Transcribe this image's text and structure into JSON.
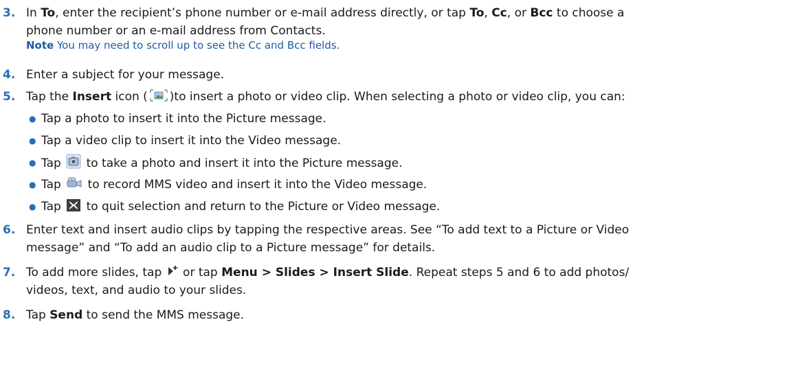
{
  "step3": {
    "num": "3.",
    "p1": "In ",
    "b1": "To",
    "p2": ", enter the recipient’s phone number or e-mail address directly, or tap ",
    "b2": "To",
    "p3": ", ",
    "b3": "Cc",
    "p4": ", or ",
    "b4": "Bcc",
    "p5": " to choose a",
    "line2": "phone number or an e-mail address from Contacts.",
    "note_label": "Note",
    "note_text": "  You may need to scroll up to see the Cc and Bcc fields."
  },
  "step4": {
    "num": "4.",
    "text": "Enter a subject for your message."
  },
  "step5": {
    "num": "5.",
    "p1": "Tap the ",
    "b1": "Insert",
    "p2": " icon (",
    "p3": ")to insert a photo or video clip. When selecting a photo or video clip, you can:"
  },
  "bullets": {
    "b1": "Tap a photo to insert it into the Picture message.",
    "b2": "Tap a video clip to insert it into the Video message.",
    "b3_pre": " Tap ",
    "b3_post": " to take a photo and insert it into the Picture message.",
    "b4_pre": "Tap ",
    "b4_post": " to record MMS video and insert it into the Video message.",
    "b5_pre": "Tap ",
    "b5_post": " to quit selection and return to the Picture or Video message."
  },
  "step6": {
    "num": "6.",
    "line1": "Enter text and insert audio clips by tapping the respective areas. See “To add text to a Picture or Video",
    "line2": "message” and “To add an audio clip to a Picture message” for details."
  },
  "step7": {
    "num": "7.",
    "p1": "To add more slides, tap ",
    "p2": " or tap ",
    "b1": "Menu > Slides > Insert Slide",
    "p3": ". Repeat steps 5 and 6 to add photos/",
    "line2": "videos, text, and audio to your slides."
  },
  "step8": {
    "num": "8.",
    "p1": "Tap ",
    "b1": "Send",
    "p2": " to send the MMS message."
  },
  "icons": {
    "insert": "insert-media-icon",
    "camera": "camera-icon",
    "video": "video-camera-icon",
    "close": "close-x-icon",
    "slide": "add-slide-icon"
  },
  "colors": {
    "accent": "#2c6db5",
    "note": "#1f5aa6"
  }
}
